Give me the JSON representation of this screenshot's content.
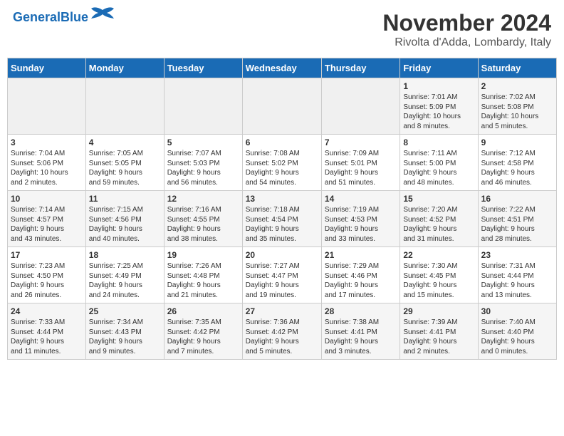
{
  "header": {
    "logo_line1": "General",
    "logo_line2": "Blue",
    "main_title": "November 2024",
    "subtitle": "Rivolta d'Adda, Lombardy, Italy"
  },
  "weekdays": [
    "Sunday",
    "Monday",
    "Tuesday",
    "Wednesday",
    "Thursday",
    "Friday",
    "Saturday"
  ],
  "weeks": [
    [
      {
        "day": "",
        "info": ""
      },
      {
        "day": "",
        "info": ""
      },
      {
        "day": "",
        "info": ""
      },
      {
        "day": "",
        "info": ""
      },
      {
        "day": "",
        "info": ""
      },
      {
        "day": "1",
        "info": "Sunrise: 7:01 AM\nSunset: 5:09 PM\nDaylight: 10 hours\nand 8 minutes."
      },
      {
        "day": "2",
        "info": "Sunrise: 7:02 AM\nSunset: 5:08 PM\nDaylight: 10 hours\nand 5 minutes."
      }
    ],
    [
      {
        "day": "3",
        "info": "Sunrise: 7:04 AM\nSunset: 5:06 PM\nDaylight: 10 hours\nand 2 minutes."
      },
      {
        "day": "4",
        "info": "Sunrise: 7:05 AM\nSunset: 5:05 PM\nDaylight: 9 hours\nand 59 minutes."
      },
      {
        "day": "5",
        "info": "Sunrise: 7:07 AM\nSunset: 5:03 PM\nDaylight: 9 hours\nand 56 minutes."
      },
      {
        "day": "6",
        "info": "Sunrise: 7:08 AM\nSunset: 5:02 PM\nDaylight: 9 hours\nand 54 minutes."
      },
      {
        "day": "7",
        "info": "Sunrise: 7:09 AM\nSunset: 5:01 PM\nDaylight: 9 hours\nand 51 minutes."
      },
      {
        "day": "8",
        "info": "Sunrise: 7:11 AM\nSunset: 5:00 PM\nDaylight: 9 hours\nand 48 minutes."
      },
      {
        "day": "9",
        "info": "Sunrise: 7:12 AM\nSunset: 4:58 PM\nDaylight: 9 hours\nand 46 minutes."
      }
    ],
    [
      {
        "day": "10",
        "info": "Sunrise: 7:14 AM\nSunset: 4:57 PM\nDaylight: 9 hours\nand 43 minutes."
      },
      {
        "day": "11",
        "info": "Sunrise: 7:15 AM\nSunset: 4:56 PM\nDaylight: 9 hours\nand 40 minutes."
      },
      {
        "day": "12",
        "info": "Sunrise: 7:16 AM\nSunset: 4:55 PM\nDaylight: 9 hours\nand 38 minutes."
      },
      {
        "day": "13",
        "info": "Sunrise: 7:18 AM\nSunset: 4:54 PM\nDaylight: 9 hours\nand 35 minutes."
      },
      {
        "day": "14",
        "info": "Sunrise: 7:19 AM\nSunset: 4:53 PM\nDaylight: 9 hours\nand 33 minutes."
      },
      {
        "day": "15",
        "info": "Sunrise: 7:20 AM\nSunset: 4:52 PM\nDaylight: 9 hours\nand 31 minutes."
      },
      {
        "day": "16",
        "info": "Sunrise: 7:22 AM\nSunset: 4:51 PM\nDaylight: 9 hours\nand 28 minutes."
      }
    ],
    [
      {
        "day": "17",
        "info": "Sunrise: 7:23 AM\nSunset: 4:50 PM\nDaylight: 9 hours\nand 26 minutes."
      },
      {
        "day": "18",
        "info": "Sunrise: 7:25 AM\nSunset: 4:49 PM\nDaylight: 9 hours\nand 24 minutes."
      },
      {
        "day": "19",
        "info": "Sunrise: 7:26 AM\nSunset: 4:48 PM\nDaylight: 9 hours\nand 21 minutes."
      },
      {
        "day": "20",
        "info": "Sunrise: 7:27 AM\nSunset: 4:47 PM\nDaylight: 9 hours\nand 19 minutes."
      },
      {
        "day": "21",
        "info": "Sunrise: 7:29 AM\nSunset: 4:46 PM\nDaylight: 9 hours\nand 17 minutes."
      },
      {
        "day": "22",
        "info": "Sunrise: 7:30 AM\nSunset: 4:45 PM\nDaylight: 9 hours\nand 15 minutes."
      },
      {
        "day": "23",
        "info": "Sunrise: 7:31 AM\nSunset: 4:44 PM\nDaylight: 9 hours\nand 13 minutes."
      }
    ],
    [
      {
        "day": "24",
        "info": "Sunrise: 7:33 AM\nSunset: 4:44 PM\nDaylight: 9 hours\nand 11 minutes."
      },
      {
        "day": "25",
        "info": "Sunrise: 7:34 AM\nSunset: 4:43 PM\nDaylight: 9 hours\nand 9 minutes."
      },
      {
        "day": "26",
        "info": "Sunrise: 7:35 AM\nSunset: 4:42 PM\nDaylight: 9 hours\nand 7 minutes."
      },
      {
        "day": "27",
        "info": "Sunrise: 7:36 AM\nSunset: 4:42 PM\nDaylight: 9 hours\nand 5 minutes."
      },
      {
        "day": "28",
        "info": "Sunrise: 7:38 AM\nSunset: 4:41 PM\nDaylight: 9 hours\nand 3 minutes."
      },
      {
        "day": "29",
        "info": "Sunrise: 7:39 AM\nSunset: 4:41 PM\nDaylight: 9 hours\nand 2 minutes."
      },
      {
        "day": "30",
        "info": "Sunrise: 7:40 AM\nSunset: 4:40 PM\nDaylight: 9 hours\nand 0 minutes."
      }
    ]
  ]
}
